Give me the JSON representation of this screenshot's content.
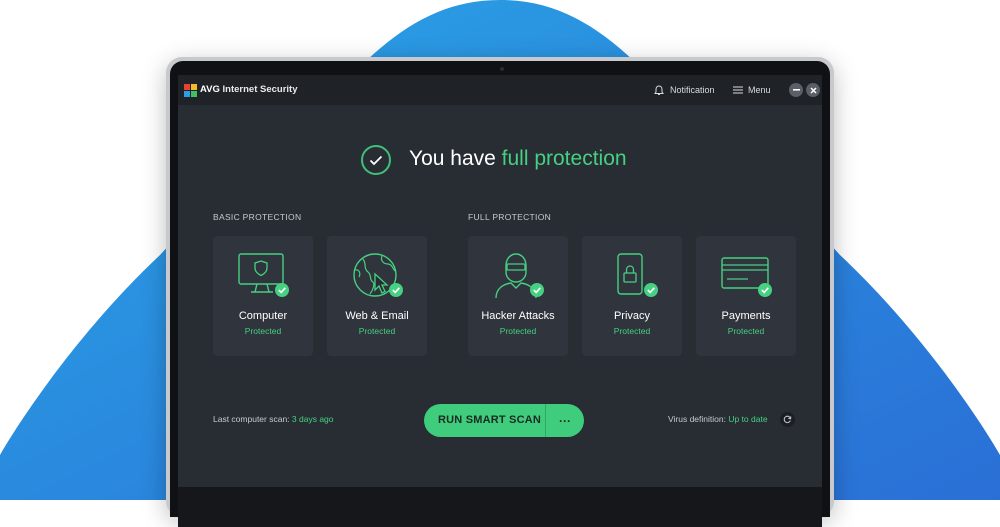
{
  "colors": {
    "accent": "#46d082",
    "background": "#282c33",
    "blob": "#2b8fe0"
  },
  "titlebar": {
    "brand": "AVG",
    "product": "Internet Security",
    "notification_label": "Notification",
    "menu_label": "Menu"
  },
  "hero": {
    "prefix": "You have",
    "highlight": "full protection"
  },
  "sections": {
    "basic_label": "BASIC PROTECTION",
    "full_label": "FULL PROTECTION"
  },
  "cards": [
    {
      "title": "Computer",
      "status": "Protected",
      "icon": "monitor-shield-icon"
    },
    {
      "title": "Web & Email",
      "status": "Protected",
      "icon": "globe-cursor-icon"
    },
    {
      "title": "Hacker Attacks",
      "status": "Protected",
      "icon": "hacker-icon"
    },
    {
      "title": "Privacy",
      "status": "Protected",
      "icon": "phone-lock-icon"
    },
    {
      "title": "Payments",
      "status": "Protected",
      "icon": "credit-card-icon"
    }
  ],
  "footer": {
    "last_scan_label": "Last computer scan:",
    "last_scan_value": "3 days ago",
    "scan_button_label": "RUN SMART SCAN",
    "more_label": "···",
    "virus_def_label": "Virus definition:",
    "virus_def_value": "Up to date"
  }
}
